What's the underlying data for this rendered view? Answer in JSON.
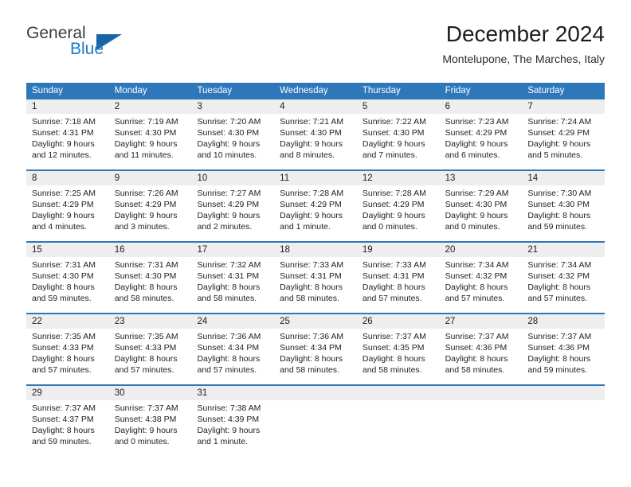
{
  "brand": {
    "name_part1": "General",
    "name_part2": "Blue",
    "logo_icon": "triangle-flag-icon"
  },
  "header": {
    "title": "December 2024",
    "subtitle": "Montelupone, The Marches, Italy"
  },
  "colors": {
    "header_blue": "#2e77bb",
    "daynum_band": "#eeeeee",
    "brand_blue": "#2079c4",
    "text": "#1f1f1f"
  },
  "weekdays": [
    "Sunday",
    "Monday",
    "Tuesday",
    "Wednesday",
    "Thursday",
    "Friday",
    "Saturday"
  ],
  "weeks": [
    [
      {
        "day": "1",
        "sunrise": "Sunrise: 7:18 AM",
        "sunset": "Sunset: 4:31 PM",
        "daylight1": "Daylight: 9 hours",
        "daylight2": "and 12 minutes."
      },
      {
        "day": "2",
        "sunrise": "Sunrise: 7:19 AM",
        "sunset": "Sunset: 4:30 PM",
        "daylight1": "Daylight: 9 hours",
        "daylight2": "and 11 minutes."
      },
      {
        "day": "3",
        "sunrise": "Sunrise: 7:20 AM",
        "sunset": "Sunset: 4:30 PM",
        "daylight1": "Daylight: 9 hours",
        "daylight2": "and 10 minutes."
      },
      {
        "day": "4",
        "sunrise": "Sunrise: 7:21 AM",
        "sunset": "Sunset: 4:30 PM",
        "daylight1": "Daylight: 9 hours",
        "daylight2": "and 8 minutes."
      },
      {
        "day": "5",
        "sunrise": "Sunrise: 7:22 AM",
        "sunset": "Sunset: 4:30 PM",
        "daylight1": "Daylight: 9 hours",
        "daylight2": "and 7 minutes."
      },
      {
        "day": "6",
        "sunrise": "Sunrise: 7:23 AM",
        "sunset": "Sunset: 4:29 PM",
        "daylight1": "Daylight: 9 hours",
        "daylight2": "and 6 minutes."
      },
      {
        "day": "7",
        "sunrise": "Sunrise: 7:24 AM",
        "sunset": "Sunset: 4:29 PM",
        "daylight1": "Daylight: 9 hours",
        "daylight2": "and 5 minutes."
      }
    ],
    [
      {
        "day": "8",
        "sunrise": "Sunrise: 7:25 AM",
        "sunset": "Sunset: 4:29 PM",
        "daylight1": "Daylight: 9 hours",
        "daylight2": "and 4 minutes."
      },
      {
        "day": "9",
        "sunrise": "Sunrise: 7:26 AM",
        "sunset": "Sunset: 4:29 PM",
        "daylight1": "Daylight: 9 hours",
        "daylight2": "and 3 minutes."
      },
      {
        "day": "10",
        "sunrise": "Sunrise: 7:27 AM",
        "sunset": "Sunset: 4:29 PM",
        "daylight1": "Daylight: 9 hours",
        "daylight2": "and 2 minutes."
      },
      {
        "day": "11",
        "sunrise": "Sunrise: 7:28 AM",
        "sunset": "Sunset: 4:29 PM",
        "daylight1": "Daylight: 9 hours",
        "daylight2": "and 1 minute."
      },
      {
        "day": "12",
        "sunrise": "Sunrise: 7:28 AM",
        "sunset": "Sunset: 4:29 PM",
        "daylight1": "Daylight: 9 hours",
        "daylight2": "and 0 minutes."
      },
      {
        "day": "13",
        "sunrise": "Sunrise: 7:29 AM",
        "sunset": "Sunset: 4:30 PM",
        "daylight1": "Daylight: 9 hours",
        "daylight2": "and 0 minutes."
      },
      {
        "day": "14",
        "sunrise": "Sunrise: 7:30 AM",
        "sunset": "Sunset: 4:30 PM",
        "daylight1": "Daylight: 8 hours",
        "daylight2": "and 59 minutes."
      }
    ],
    [
      {
        "day": "15",
        "sunrise": "Sunrise: 7:31 AM",
        "sunset": "Sunset: 4:30 PM",
        "daylight1": "Daylight: 8 hours",
        "daylight2": "and 59 minutes."
      },
      {
        "day": "16",
        "sunrise": "Sunrise: 7:31 AM",
        "sunset": "Sunset: 4:30 PM",
        "daylight1": "Daylight: 8 hours",
        "daylight2": "and 58 minutes."
      },
      {
        "day": "17",
        "sunrise": "Sunrise: 7:32 AM",
        "sunset": "Sunset: 4:31 PM",
        "daylight1": "Daylight: 8 hours",
        "daylight2": "and 58 minutes."
      },
      {
        "day": "18",
        "sunrise": "Sunrise: 7:33 AM",
        "sunset": "Sunset: 4:31 PM",
        "daylight1": "Daylight: 8 hours",
        "daylight2": "and 58 minutes."
      },
      {
        "day": "19",
        "sunrise": "Sunrise: 7:33 AM",
        "sunset": "Sunset: 4:31 PM",
        "daylight1": "Daylight: 8 hours",
        "daylight2": "and 57 minutes."
      },
      {
        "day": "20",
        "sunrise": "Sunrise: 7:34 AM",
        "sunset": "Sunset: 4:32 PM",
        "daylight1": "Daylight: 8 hours",
        "daylight2": "and 57 minutes."
      },
      {
        "day": "21",
        "sunrise": "Sunrise: 7:34 AM",
        "sunset": "Sunset: 4:32 PM",
        "daylight1": "Daylight: 8 hours",
        "daylight2": "and 57 minutes."
      }
    ],
    [
      {
        "day": "22",
        "sunrise": "Sunrise: 7:35 AM",
        "sunset": "Sunset: 4:33 PM",
        "daylight1": "Daylight: 8 hours",
        "daylight2": "and 57 minutes."
      },
      {
        "day": "23",
        "sunrise": "Sunrise: 7:35 AM",
        "sunset": "Sunset: 4:33 PM",
        "daylight1": "Daylight: 8 hours",
        "daylight2": "and 57 minutes."
      },
      {
        "day": "24",
        "sunrise": "Sunrise: 7:36 AM",
        "sunset": "Sunset: 4:34 PM",
        "daylight1": "Daylight: 8 hours",
        "daylight2": "and 57 minutes."
      },
      {
        "day": "25",
        "sunrise": "Sunrise: 7:36 AM",
        "sunset": "Sunset: 4:34 PM",
        "daylight1": "Daylight: 8 hours",
        "daylight2": "and 58 minutes."
      },
      {
        "day": "26",
        "sunrise": "Sunrise: 7:37 AM",
        "sunset": "Sunset: 4:35 PM",
        "daylight1": "Daylight: 8 hours",
        "daylight2": "and 58 minutes."
      },
      {
        "day": "27",
        "sunrise": "Sunrise: 7:37 AM",
        "sunset": "Sunset: 4:36 PM",
        "daylight1": "Daylight: 8 hours",
        "daylight2": "and 58 minutes."
      },
      {
        "day": "28",
        "sunrise": "Sunrise: 7:37 AM",
        "sunset": "Sunset: 4:36 PM",
        "daylight1": "Daylight: 8 hours",
        "daylight2": "and 59 minutes."
      }
    ],
    [
      {
        "day": "29",
        "sunrise": "Sunrise: 7:37 AM",
        "sunset": "Sunset: 4:37 PM",
        "daylight1": "Daylight: 8 hours",
        "daylight2": "and 59 minutes."
      },
      {
        "day": "30",
        "sunrise": "Sunrise: 7:37 AM",
        "sunset": "Sunset: 4:38 PM",
        "daylight1": "Daylight: 9 hours",
        "daylight2": "and 0 minutes."
      },
      {
        "day": "31",
        "sunrise": "Sunrise: 7:38 AM",
        "sunset": "Sunset: 4:39 PM",
        "daylight1": "Daylight: 9 hours",
        "daylight2": "and 1 minute."
      },
      {
        "day": "",
        "sunrise": "",
        "sunset": "",
        "daylight1": "",
        "daylight2": ""
      },
      {
        "day": "",
        "sunrise": "",
        "sunset": "",
        "daylight1": "",
        "daylight2": ""
      },
      {
        "day": "",
        "sunrise": "",
        "sunset": "",
        "daylight1": "",
        "daylight2": ""
      },
      {
        "day": "",
        "sunrise": "",
        "sunset": "",
        "daylight1": "",
        "daylight2": ""
      }
    ]
  ]
}
